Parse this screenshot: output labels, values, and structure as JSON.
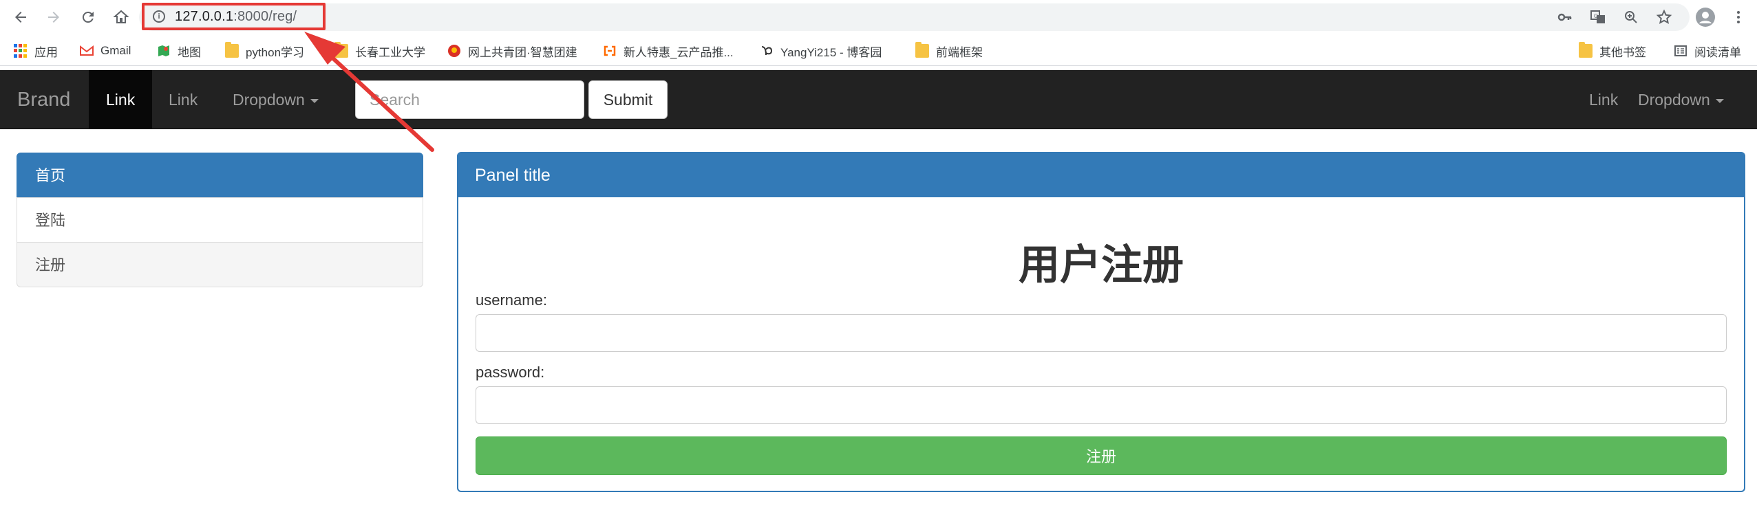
{
  "browser": {
    "url_host": "127.0.0.1",
    "url_rest": ":8000/reg/",
    "bookmarks": [
      {
        "label": "应用",
        "icon": "apps-grid-icon"
      },
      {
        "label": "Gmail",
        "icon": "gmail-icon"
      },
      {
        "label": "地图",
        "icon": "maps-icon"
      },
      {
        "label": "python学习",
        "icon": "folder-icon"
      },
      {
        "label": "长春工业大学",
        "icon": "folder-icon"
      },
      {
        "label": "网上共青团·智慧团建",
        "icon": "league-icon"
      },
      {
        "label": "新人特惠_云产品推...",
        "icon": "aliyun-icon"
      },
      {
        "label": "YangYi215 - 博客园",
        "icon": "cnblogs-icon"
      },
      {
        "label": "前端框架",
        "icon": "folder-icon"
      }
    ],
    "other_bookmarks": "其他书签",
    "reading_list": "阅读清单"
  },
  "navbar": {
    "brand": "Brand",
    "link1": "Link",
    "link2": "Link",
    "dropdown": "Dropdown",
    "search_placeholder": "Search",
    "submit": "Submit",
    "right_link": "Link",
    "right_dropdown": "Dropdown"
  },
  "sidebar": {
    "items": [
      {
        "label": "首页"
      },
      {
        "label": "登陆"
      },
      {
        "label": "注册"
      }
    ]
  },
  "panel": {
    "title": "Panel title",
    "form_title": "用户注册",
    "username_label": "username:",
    "username_value": "",
    "password_label": "password:",
    "password_value": "",
    "submit": "注册"
  },
  "colors": {
    "navbar_bg": "#222222",
    "primary": "#337ab7",
    "success": "#5cb85c",
    "annotation": "#e53935"
  }
}
